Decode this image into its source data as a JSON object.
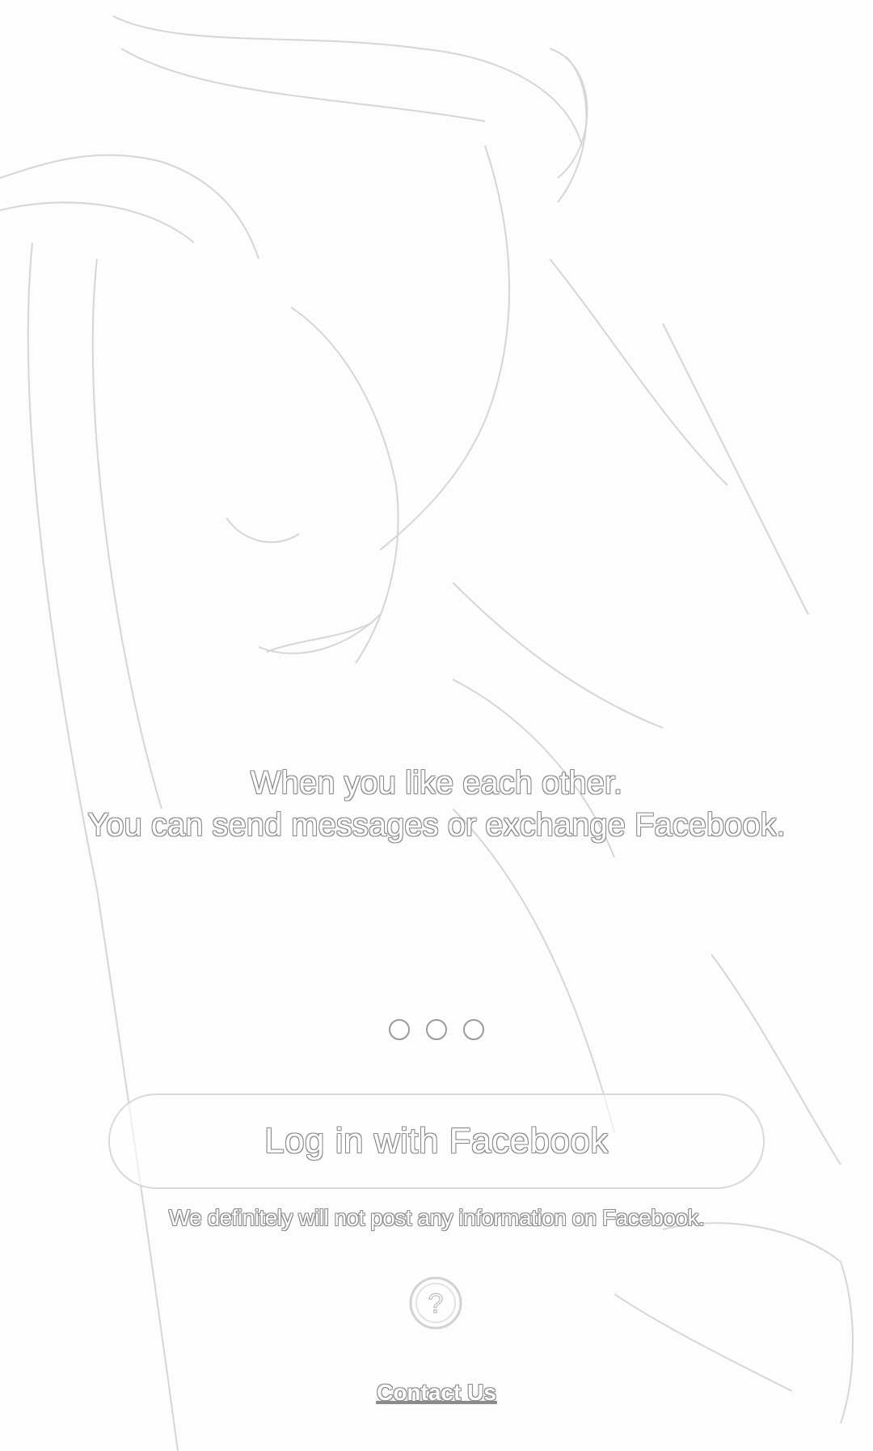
{
  "onboarding": {
    "tagline_line1": "When you like each other.",
    "tagline_line2": "You can send messages or exchange Facebook.",
    "page_indicator": {
      "total": 3,
      "active_index": 0
    }
  },
  "login": {
    "facebook_button_label": "Log in with Facebook",
    "disclaimer": "We definitely will not post any information on Facebook."
  },
  "footer": {
    "help_icon": "question-circle-icon",
    "help_glyph": "?",
    "contact_label": "Contact Us"
  },
  "colors": {
    "background": "#fdfdfd",
    "outline": "#8a8a8a",
    "text_fill": "#ffffff"
  }
}
